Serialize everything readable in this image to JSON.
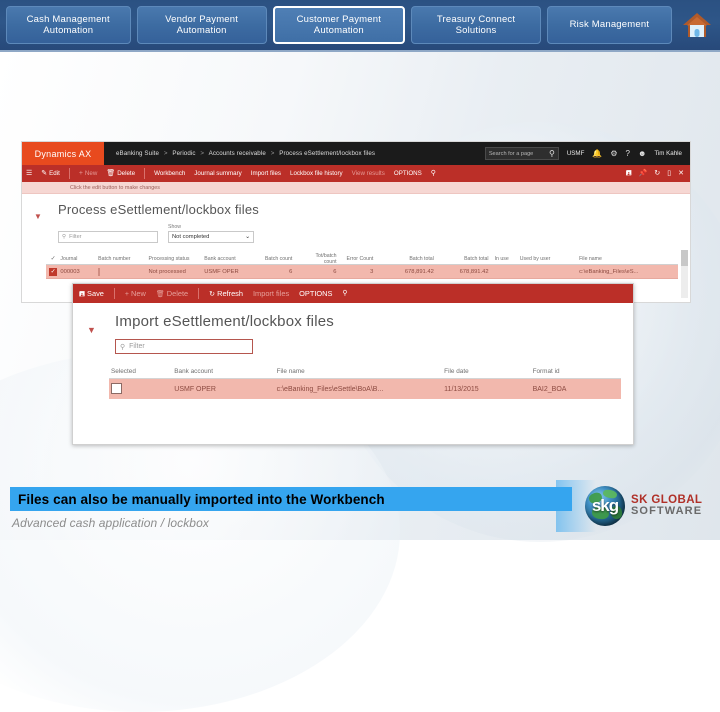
{
  "topnav": {
    "buttons": [
      {
        "line1": "Cash Management",
        "line2": "Automation"
      },
      {
        "line1": "Vendor  Payment",
        "line2": "Automation"
      },
      {
        "line1": "Customer Payment",
        "line2": "Automation"
      },
      {
        "line1": "Treasury Connect",
        "line2": "Solutions"
      },
      {
        "line1": "Risk Management",
        "line2": ""
      }
    ],
    "home_icon": "home-icon",
    "accent": "#2e5688",
    "button_fill": "#3d6ca2",
    "active_index": 2
  },
  "ax": {
    "logo": "Dynamics AX",
    "breadcrumb": [
      "eBanking Suite",
      "Periodic",
      "Accounts receivable",
      "Process eSettlement/lockbox files"
    ],
    "search_placeholder": "Search for a page",
    "company": "USMF",
    "user": "Tim Kahle",
    "topright_icons": [
      "search-icon",
      "bell-icon",
      "gear-icon",
      "help-icon",
      "user-icon"
    ],
    "actions": [
      {
        "label": "Edit",
        "icon": "pencil-icon",
        "disabled": false
      },
      {
        "label": "New",
        "icon": "plus-icon",
        "disabled": true
      },
      {
        "label": "Delete",
        "icon": "trash-icon",
        "disabled": false
      },
      {
        "label": "Workbench",
        "icon": "",
        "disabled": false
      },
      {
        "label": "Journal summary",
        "icon": "",
        "disabled": false
      },
      {
        "label": "Import files",
        "icon": "",
        "disabled": false
      },
      {
        "label": "Lockbox file history",
        "icon": "",
        "disabled": false
      },
      {
        "label": "View results",
        "icon": "",
        "disabled": true
      },
      {
        "label": "OPTIONS",
        "icon": "",
        "disabled": false
      }
    ],
    "pane_right_icons": [
      "save-icon",
      "pin-icon",
      "refresh-icon",
      "window-icon",
      "close-icon"
    ],
    "message": "Click the edit button to make changes",
    "page_title": "Process eSettlement/lockbox files",
    "filter_placeholder": "Filter",
    "show_label": "Show",
    "show_value": "Not completed",
    "grid": {
      "headers": [
        "Journal",
        "Batch number",
        "Processing status",
        "Bank account",
        "Batch count",
        "Tot/batch count",
        "Error Count",
        "Batch total",
        "Batch total",
        "In use",
        "Used by user",
        "File name"
      ],
      "rows": [
        {
          "selected": true,
          "journal": "000003",
          "batch_number": "",
          "processing_status": "Not processed",
          "bank_account": "USMF OPER",
          "batch_count": "6",
          "tot_batch_count": "6",
          "error_count": "3",
          "batch_total": "678,891.42",
          "batch_total_2": "678,891.42",
          "in_use": "",
          "used_by_user": "",
          "file_name": "c:\\eBanking_Files\\eS..."
        }
      ]
    }
  },
  "import_window": {
    "actions": [
      {
        "label": "Save",
        "icon": "save-icon",
        "disabled": false
      },
      {
        "label": "New",
        "icon": "plus-icon",
        "disabled": true
      },
      {
        "label": "Delete",
        "icon": "trash-icon",
        "disabled": true
      },
      {
        "label": "Refresh",
        "icon": "refresh-icon",
        "disabled": false
      },
      {
        "label": "Import files",
        "icon": "",
        "disabled": true
      },
      {
        "label": "OPTIONS",
        "icon": "",
        "disabled": false
      }
    ],
    "search_icon": "search-icon",
    "title": "Import eSettlement/lockbox files",
    "filter_placeholder": "Filter",
    "grid": {
      "headers": [
        "Selected",
        "Bank account",
        "File name",
        "File date",
        "Format id"
      ],
      "rows": [
        {
          "selected": false,
          "bank_account": "USMF OPER",
          "file_name": "c:\\eBanking_Files\\eSettle\\BoA\\B...",
          "file_date": "11/13/2015",
          "format_id": "BAI2_BOA"
        }
      ]
    }
  },
  "caption": {
    "text": "Files can also be manually imported into the Workbench",
    "subtitle": "Advanced cash application / lockbox",
    "highlight_color": "#35a5ef"
  },
  "brand": {
    "monogram": "skg",
    "line1": "SK GLOBAL",
    "line2": "SOFTWARE",
    "line1_color": "#b03028",
    "line2_color": "#6a6a6a"
  }
}
